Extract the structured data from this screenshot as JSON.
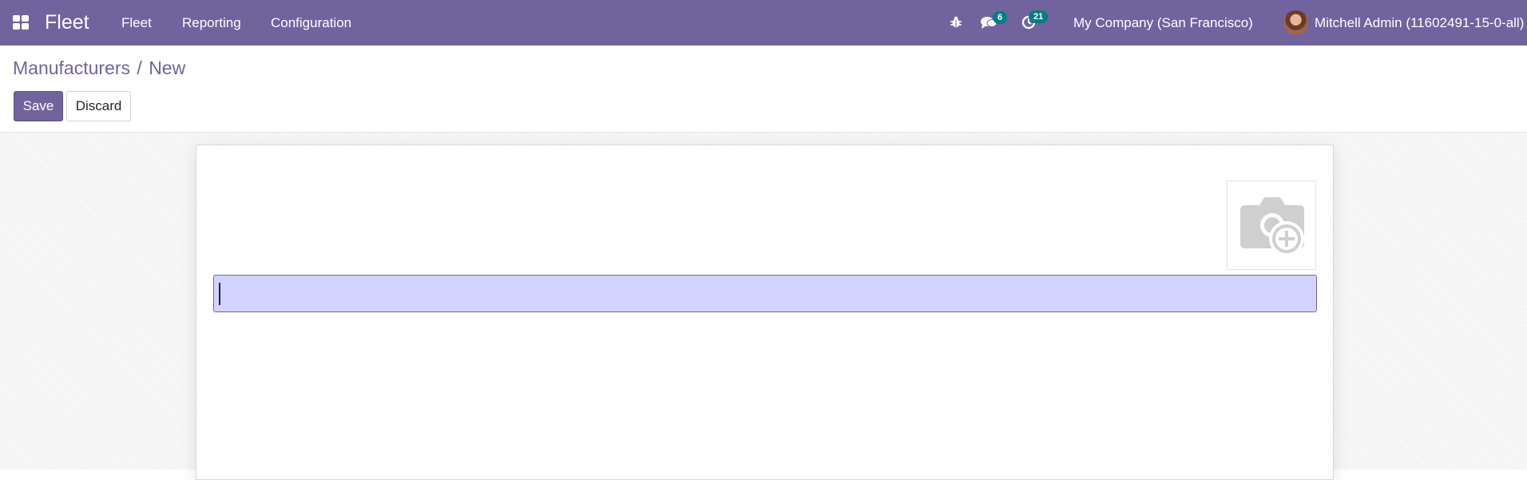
{
  "navbar": {
    "apps_icon": "apps-grid-icon",
    "brand": "Fleet",
    "menu": [
      {
        "label": "Fleet"
      },
      {
        "label": "Reporting"
      },
      {
        "label": "Configuration"
      }
    ],
    "debug_icon": "bug-icon",
    "messages_icon": "chat-icon",
    "messages_count": "6",
    "activities_icon": "clock-icon",
    "activities_count": "21",
    "company": "My Company (San Francisco)",
    "user": "Mitchell Admin (11602491-15-0-all)",
    "colors": {
      "bar": "#71639e",
      "badge": "#017e84"
    }
  },
  "control_panel": {
    "breadcrumb_parent": "Manufacturers",
    "breadcrumb_separator": "/",
    "breadcrumb_current": "New",
    "save_label": "Save",
    "discard_label": "Discard"
  },
  "form": {
    "image_placeholder_icon": "camera-plus-icon",
    "name_value": "",
    "focused_field_color": "#d3d3ff"
  }
}
